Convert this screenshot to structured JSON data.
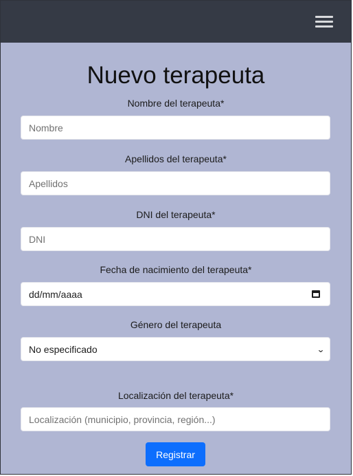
{
  "navbar": {
    "menu_icon": "hamburger-menu-icon"
  },
  "form": {
    "title": "Nuevo terapeuta",
    "fields": {
      "nombre": {
        "label": "Nombre del terapeuta*",
        "placeholder": "Nombre",
        "value": ""
      },
      "apellidos": {
        "label": "Apellidos del terapeuta*",
        "placeholder": "Apellidos",
        "value": ""
      },
      "dni": {
        "label": "DNI del terapeuta*",
        "placeholder": "DNI",
        "value": ""
      },
      "fecha": {
        "label": "Fecha de nacimiento del terapeuta*",
        "display": "dd/mm/aaaa",
        "icon": "calendar-icon"
      },
      "genero": {
        "label": "Género del terapeuta",
        "selected": "No especificado",
        "icon": "chevron-down-icon"
      },
      "localizacion": {
        "label": "Localización del terapeuta*",
        "placeholder": "Localización (municipio, provincia, región...)",
        "value": ""
      }
    },
    "submit_label": "Registrar"
  },
  "colors": {
    "navbar_bg": "#353a45",
    "page_bg": "#b0b6d3",
    "button_bg": "#0d6efd",
    "button_text": "#ffffff"
  }
}
